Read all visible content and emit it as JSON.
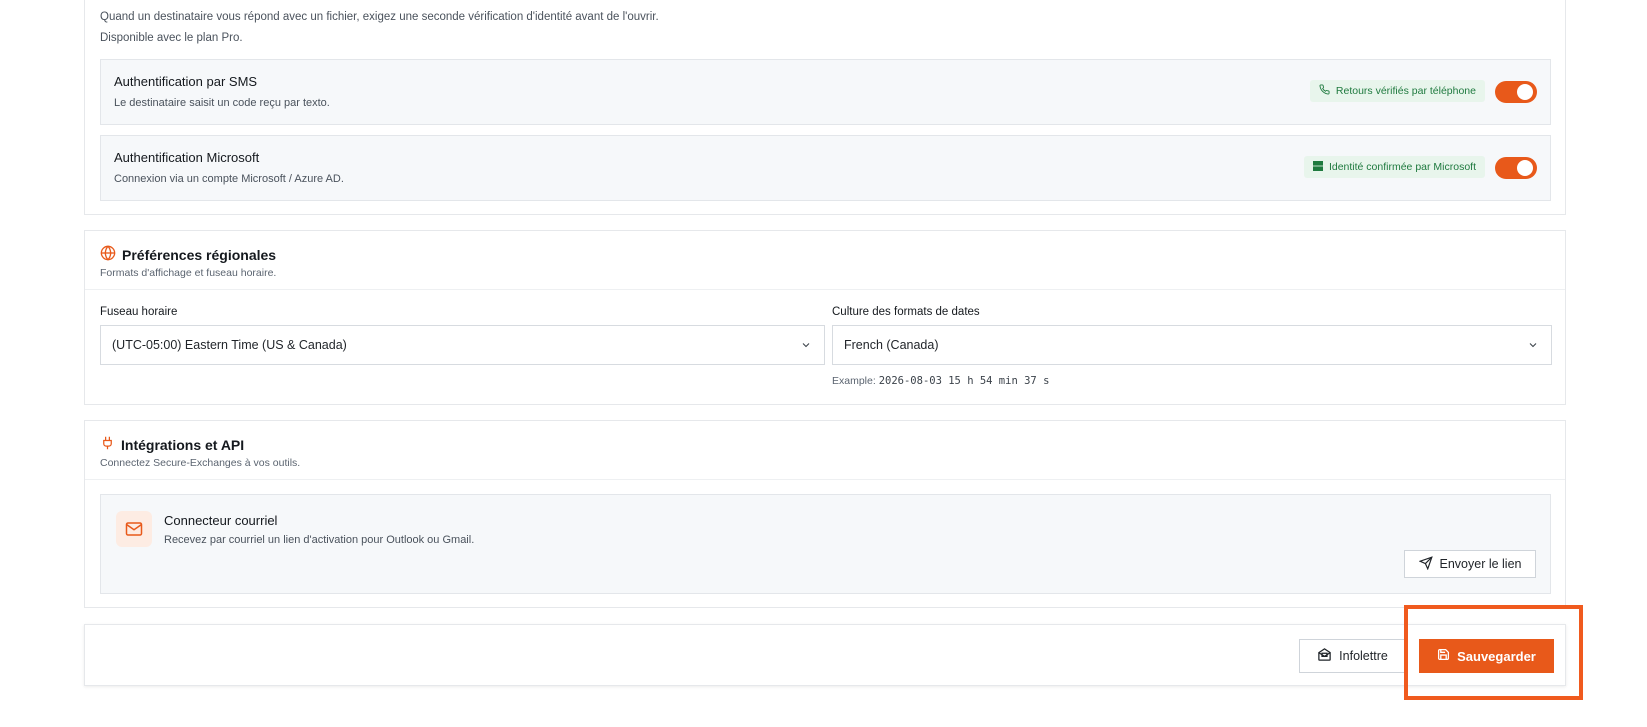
{
  "auth": {
    "desc_line1": "Quand un destinataire vous répond avec un fichier, exigez une seconde vérification d'identité avant de l'ouvrir.",
    "desc_line2": "Disponible avec le plan Pro.",
    "sms": {
      "title": "Authentification par SMS",
      "subtitle": "Le destinataire saisit un code reçu par texto.",
      "badge": "Retours vérifiés par téléphone",
      "badge_icon": "phone-icon",
      "enabled": true
    },
    "microsoft": {
      "title": "Authentification Microsoft",
      "subtitle": "Connexion via un compte Microsoft / Azure AD.",
      "badge": "Identité confirmée par Microsoft",
      "badge_icon": "microsoft-square-icon",
      "enabled": true
    }
  },
  "regional": {
    "icon": "globe-icon",
    "title": "Préférences régionales",
    "subtitle": "Formats d'affichage et fuseau horaire.",
    "timezone_label": "Fuseau horaire",
    "timezone_value": "(UTC-05:00) Eastern Time (US & Canada)",
    "culture_label": "Culture des formats de dates",
    "culture_value": "French (Canada)",
    "example_label": "Example:",
    "example_value": "2026-08-03 15 h 54 min 37 s"
  },
  "integrations": {
    "icon": "plug-icon",
    "title": "Intégrations et API",
    "subtitle": "Connectez Secure-Exchanges à vos outils.",
    "connector": {
      "icon": "mail-icon",
      "title": "Connecteur courriel",
      "subtitle": "Recevez par courriel un lien d'activation pour Outlook ou Gmail.",
      "button": "Envoyer le lien"
    }
  },
  "footer": {
    "newsletter_button": "Infolettre",
    "save_button": "Sauvegarder"
  },
  "colors": {
    "accent": "#e8591a",
    "badge_bg": "#e8f5ec",
    "badge_text": "#1f7a3f"
  }
}
